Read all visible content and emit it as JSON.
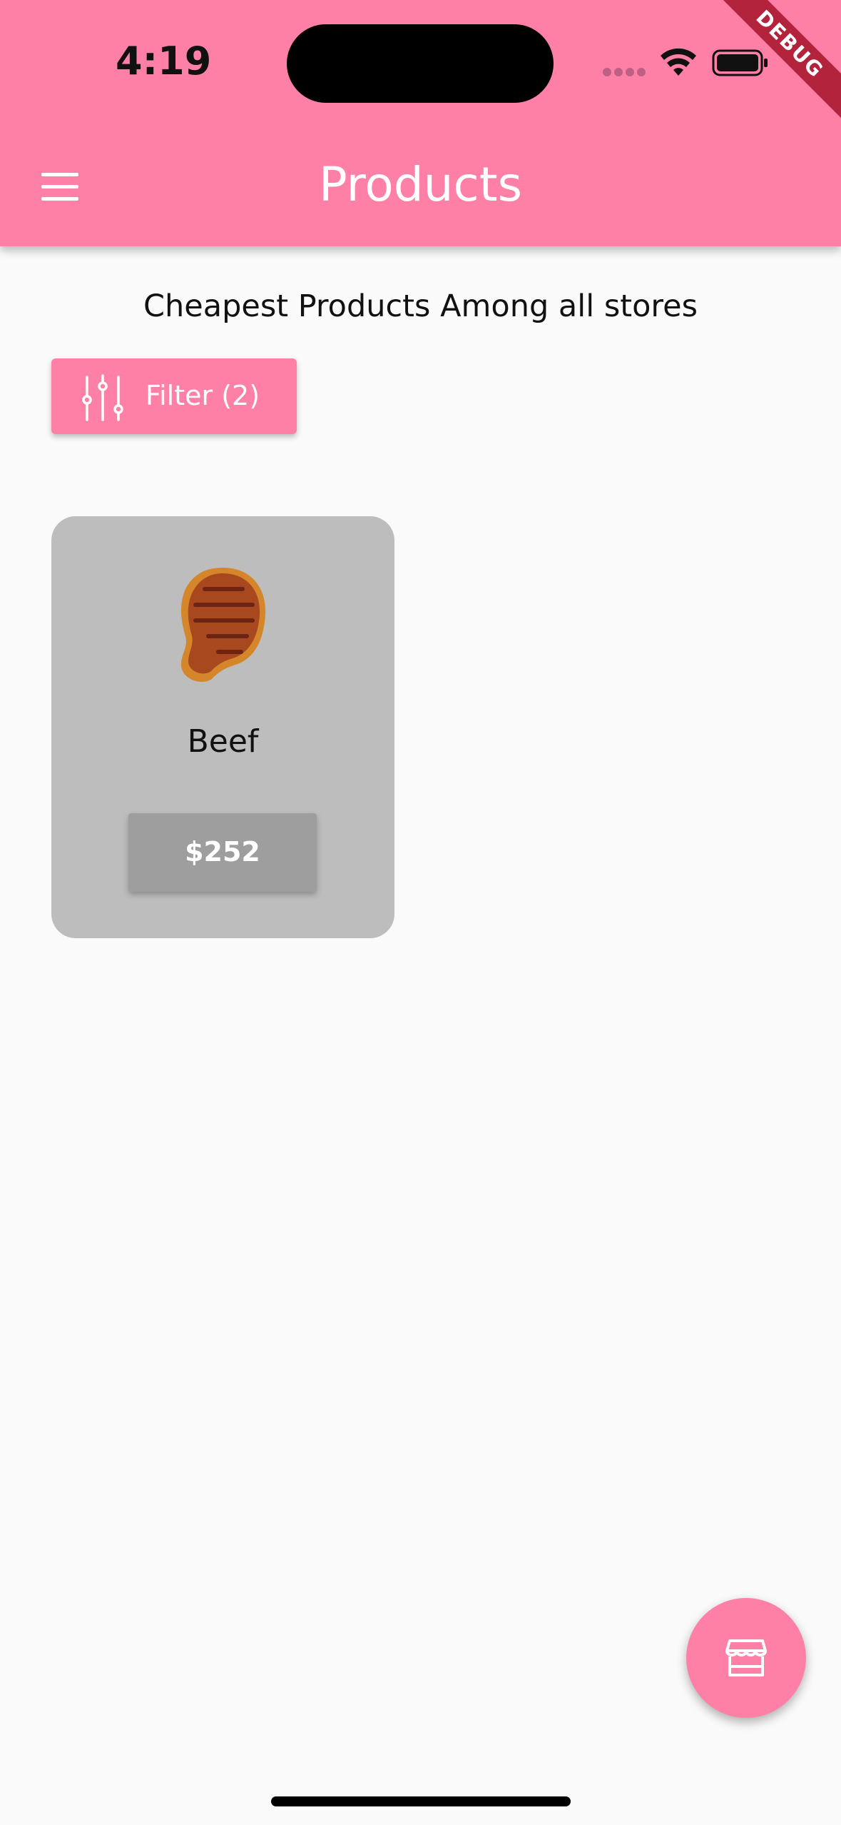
{
  "status_bar": {
    "time": "4:19"
  },
  "debug_banner": "DEBUG",
  "app_bar": {
    "title": "Products",
    "menu_icon": "hamburger-menu-icon"
  },
  "subtitle": "Cheapest Products Among all stores",
  "filter_button": {
    "label": "Filter (2)",
    "icon": "sliders-icon"
  },
  "products": [
    {
      "name": "Beef",
      "price": "$252",
      "icon": "steak-icon"
    }
  ],
  "fab": {
    "icon": "storefront-icon"
  },
  "colors": {
    "primary": "#ff80a6",
    "background": "#fafafa",
    "card": "#bdbdbd",
    "price_button": "#9e9e9e",
    "debug_ribbon": "#b4233c"
  }
}
